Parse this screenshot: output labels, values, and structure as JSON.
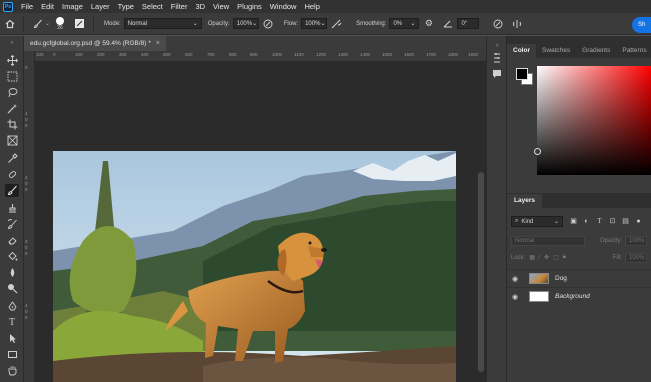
{
  "menubar": {
    "logo": "Ps",
    "items": [
      "File",
      "Edit",
      "Image",
      "Layer",
      "Type",
      "Select",
      "Filter",
      "3D",
      "View",
      "Plugins",
      "Window",
      "Help"
    ]
  },
  "options": {
    "brush_size": "26",
    "mode_label": "Mode:",
    "mode_value": "Normal",
    "opacity_label": "Opacity:",
    "opacity_value": "100%",
    "flow_label": "Flow:",
    "flow_value": "100%",
    "smoothing_label": "Smoothing:",
    "smoothing_value": "0%",
    "angle_value": "0°",
    "share_label": "Sh"
  },
  "document": {
    "tab_title": "edu.gcfglobal.org.psd @ 59.4% (RGB/8) *",
    "close": "×"
  },
  "ruler": {
    "h_ticks": [
      "100",
      "0",
      "100",
      "200",
      "300",
      "400",
      "500",
      "600",
      "700",
      "800",
      "900",
      "1000",
      "1100",
      "1200",
      "1300",
      "1400",
      "1500",
      "1600",
      "1700",
      "1800",
      "1900"
    ],
    "v_ticks": [
      "0",
      "1",
      "0",
      "0",
      "2",
      "0",
      "0",
      "3",
      "0",
      "0",
      "4",
      "0",
      "0"
    ]
  },
  "color_panel": {
    "tabs": [
      "Color",
      "Swatches",
      "Gradients",
      "Patterns"
    ],
    "active_tab": "Color"
  },
  "layers_panel": {
    "tab": "Layers",
    "kind_label": "Kind",
    "blend_mode": "Normal",
    "opacity_label": "Opacity:",
    "opacity_value": "100%",
    "lock_label": "Lock:",
    "fill_label": "Fill:",
    "fill_value": "100%",
    "layers": [
      {
        "name": "Dog",
        "italic": false
      },
      {
        "name": "Background",
        "italic": true
      }
    ]
  },
  "colors": {
    "accent": "#1473e6",
    "app_bg": "#535353",
    "panel_bg": "#3b3b3b",
    "dark_bg": "#2b2b2b"
  }
}
